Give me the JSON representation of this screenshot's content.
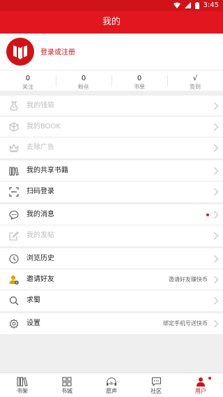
{
  "status": {
    "time": "3:45"
  },
  "header": {
    "title": "我的"
  },
  "profile": {
    "login_label": "登录或注册"
  },
  "stats": [
    {
      "value": "0",
      "label": "关注"
    },
    {
      "value": "0",
      "label": "粉丝"
    },
    {
      "value": "0",
      "label": "书单"
    },
    {
      "value": "√",
      "label": "签到"
    }
  ],
  "menu": {
    "wallet": "我的钱袋",
    "book": "我的BOOK",
    "remove_ads": "去除广告",
    "shared_books": "我的共享书籍",
    "scan_login": "扫码登录",
    "messages": "我的消息",
    "posts": "我的发帖",
    "history": "浏览历史",
    "invite": "邀请好友",
    "invite_aux": "邀请好友赚快币",
    "request": "求蜀",
    "settings": "设置",
    "settings_aux": "绑定手机号送快币"
  },
  "tabs": [
    {
      "label": "书架"
    },
    {
      "label": "书城"
    },
    {
      "label": "愿声"
    },
    {
      "label": "社区"
    },
    {
      "label": "用户"
    }
  ],
  "colors": {
    "brand_red": "#e2161e",
    "dark_red": "#d01318"
  }
}
